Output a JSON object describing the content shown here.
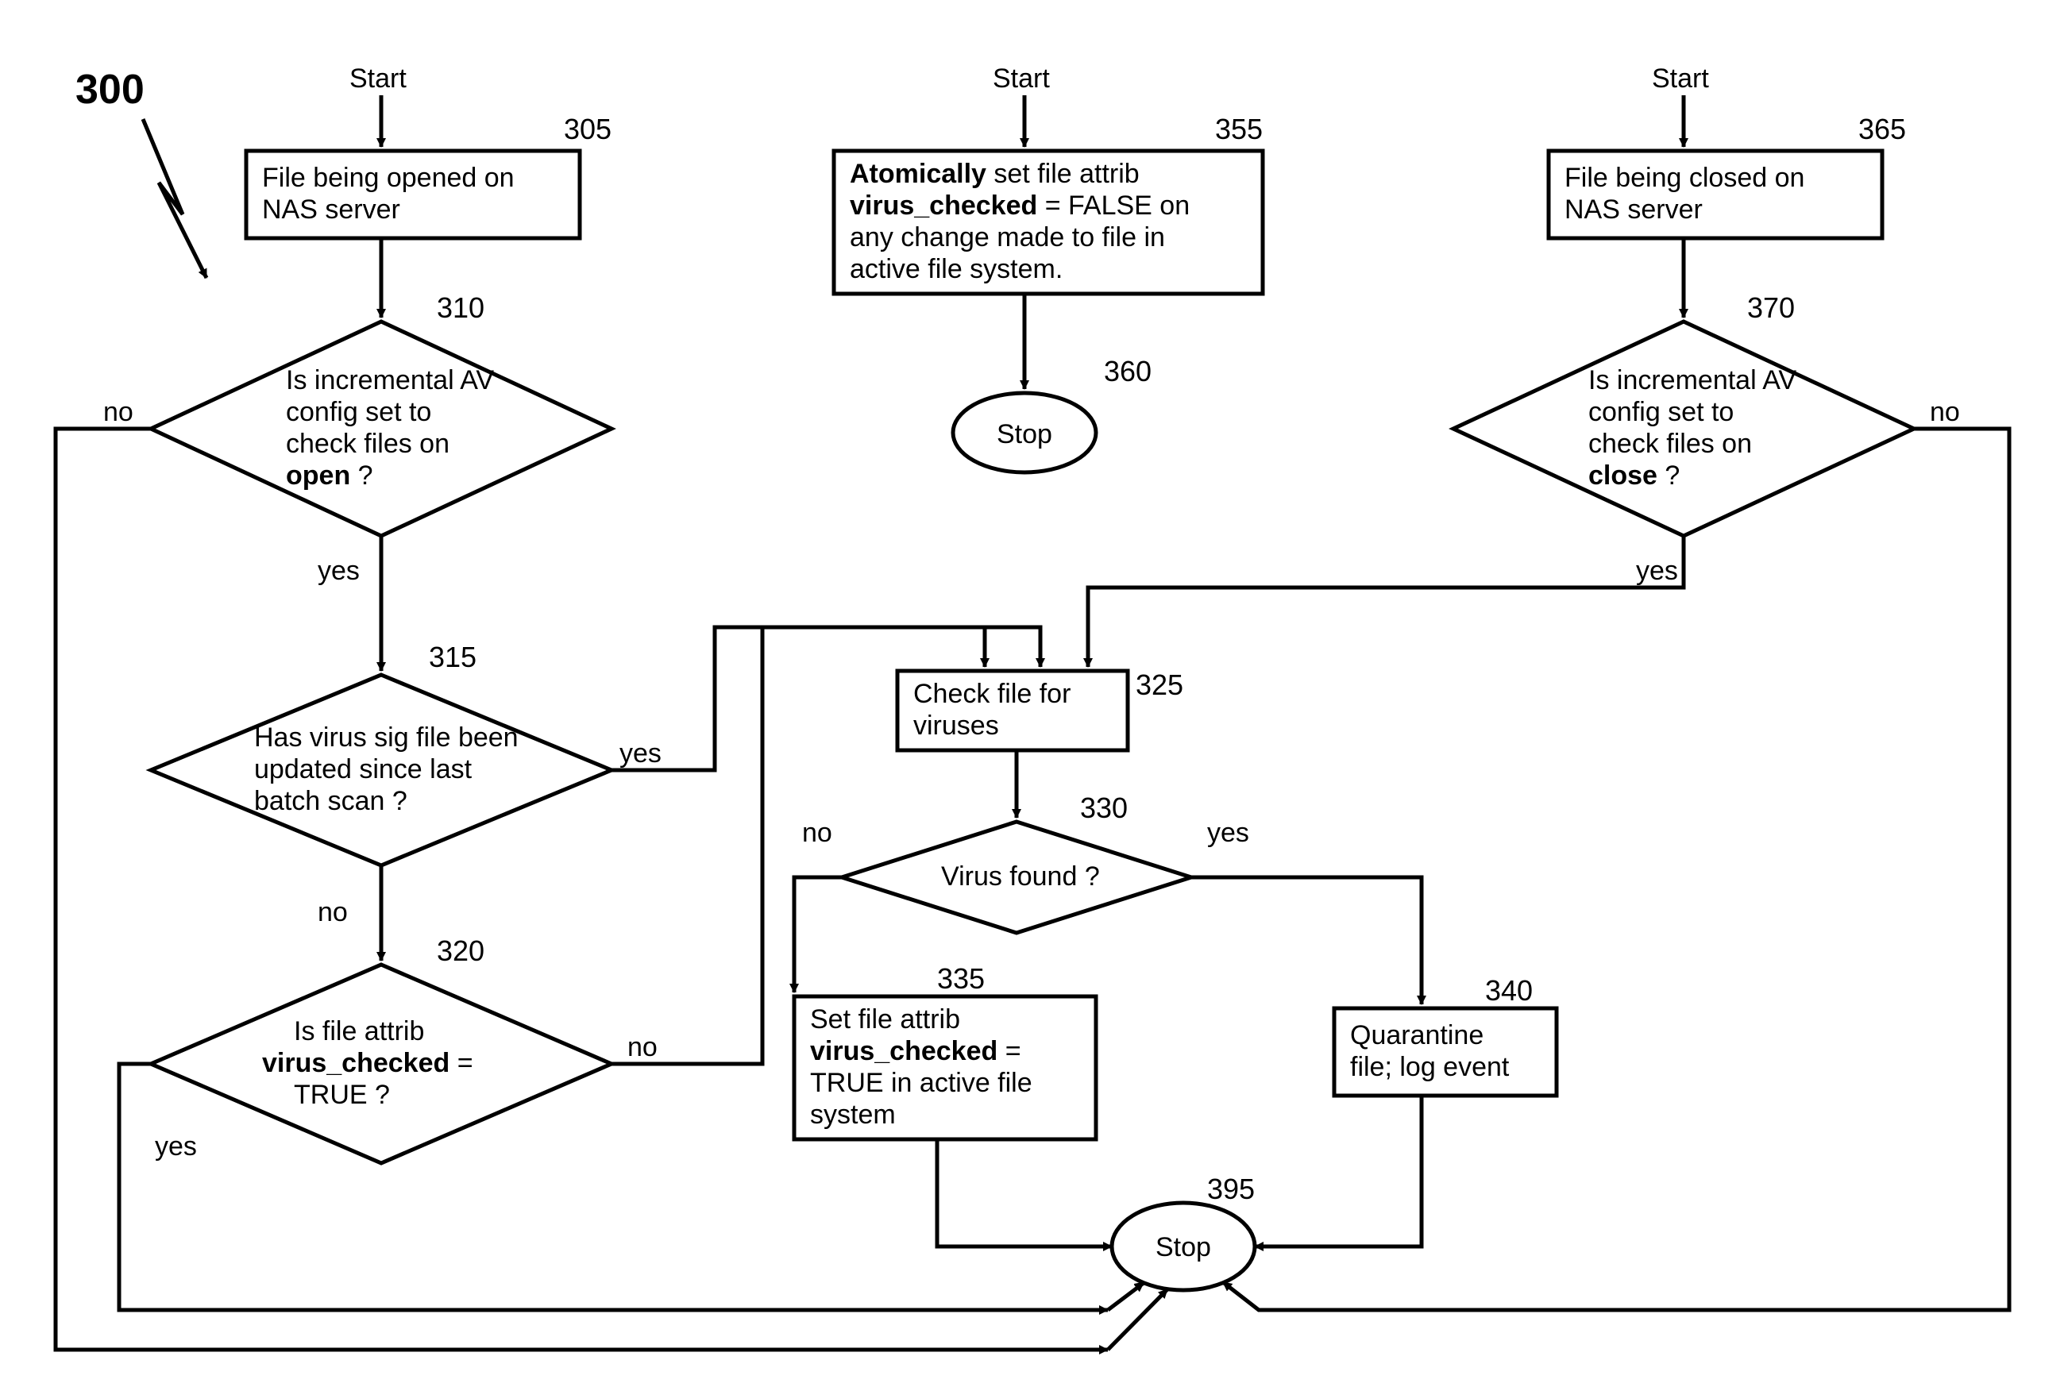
{
  "figure_label": "300",
  "nodes": {
    "start1": {
      "label": "Start"
    },
    "start2": {
      "label": "Start"
    },
    "start3": {
      "label": "Start"
    },
    "n305": {
      "num": "305",
      "line1": "File being opened on",
      "line2": "NAS server"
    },
    "n310": {
      "num": "310",
      "line1": "Is incremental AV",
      "line2": "config set to",
      "line3": "check files on",
      "line4_prefix": "open",
      "line4_suffix": " ?"
    },
    "n315": {
      "num": "315",
      "line1": "Has virus sig file been",
      "line2": "updated since last",
      "line3": "batch scan ?"
    },
    "n320": {
      "num": "320",
      "line1": "Is file attrib",
      "line2_prefix": "virus_checked",
      "line2_suffix": " =",
      "line3": "TRUE ?"
    },
    "n325": {
      "num": "325",
      "line1": "Check file for",
      "line2": "viruses"
    },
    "n330": {
      "num": "330",
      "line1": "Virus found ?"
    },
    "n335": {
      "num": "335",
      "line1": "Set file attrib",
      "line2_prefix": "virus_checked",
      "line2_suffix": " =",
      "line3": "TRUE in active file",
      "line4": "system"
    },
    "n340": {
      "num": "340",
      "line1": "Quarantine",
      "line2": "file; log event"
    },
    "n355": {
      "num": "355",
      "line1_prefix": "Atomically",
      "line1_suffix": " set file attrib",
      "line2_prefix": "virus_checked",
      "line2_suffix": " = FALSE on",
      "line3": "any change made to file in",
      "line4": "active file system."
    },
    "n360": {
      "num": "360",
      "label": "Stop"
    },
    "n365": {
      "num": "365",
      "line1": "File being closed on",
      "line2": "NAS server"
    },
    "n370": {
      "num": "370",
      "line1": "Is incremental AV",
      "line2": "config set to",
      "line3": "check files on",
      "line4_prefix": "close",
      "line4_suffix": " ?"
    },
    "n395": {
      "num": "395",
      "label": "Stop"
    }
  },
  "edges": {
    "yes": "yes",
    "no": "no"
  }
}
